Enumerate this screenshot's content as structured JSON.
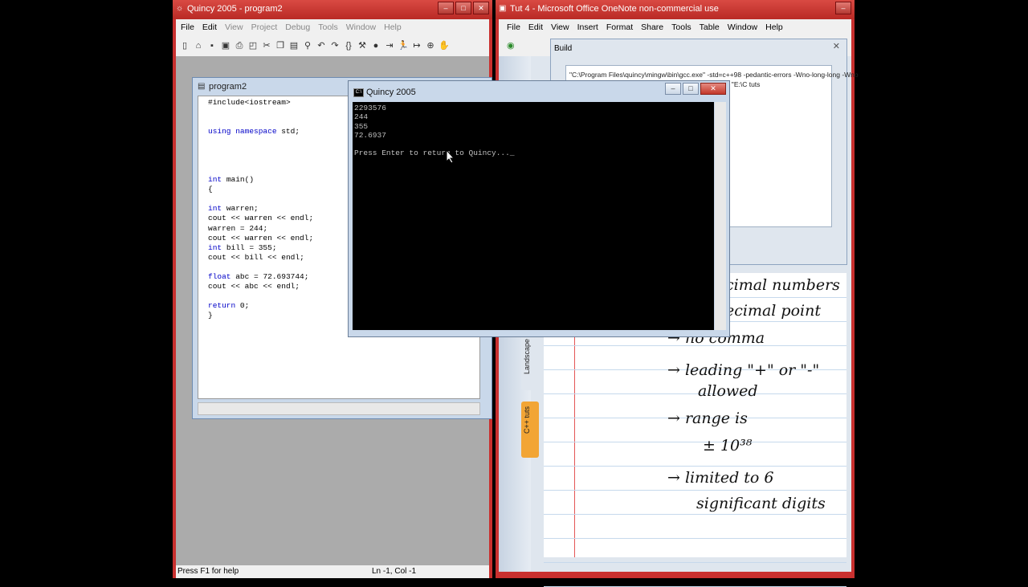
{
  "quincy": {
    "title": "Quincy 2005 - program2",
    "menu": [
      "File",
      "Edit",
      "View",
      "Project",
      "Debug",
      "Tools",
      "Window",
      "Help"
    ],
    "child_title": "program2",
    "code_lines": [
      "#include<iostream>",
      "",
      "",
      "using namespace std;",
      "",
      "",
      "",
      "",
      "int main()",
      "{",
      "",
      "int warren;",
      "cout << warren << endl;",
      "warren = 244;",
      "cout << warren << endl;",
      "int bill = 355;",
      "cout << bill << endl;",
      "",
      "float abc = 72.693744;",
      "cout << abc << endl;",
      "",
      "return 0;",
      "}"
    ],
    "status_help": "Press F1 for help",
    "status_pos": "Ln -1, Col -1"
  },
  "console": {
    "title": "Quincy 2005",
    "lines": [
      "2293576",
      "244",
      "355",
      "72.6937",
      "",
      "Press Enter to return to Quincy..._"
    ]
  },
  "onenote": {
    "title": "Tut 4 - Microsoft Office OneNote non-commercial use",
    "menu": [
      "File",
      "Edit",
      "View",
      "Insert",
      "Format",
      "Share",
      "Tools",
      "Table",
      "Window",
      "Help"
    ],
    "build_title": "Build",
    "build_lines": [
      "\"C:\\Program Files\\quincy\\mingw\\bin\\gcc.exe\" -std=c++98 -pedantic-errors -Wno-long-long -Wno",
      "\"E:\\C tuts\\program2.exe\" \"E:\\C tuts"
    ],
    "tabs": [
      "Landscape",
      "C++ tuts"
    ],
    "notes": [
      "cimal numbers",
      "ecimal point",
      "→ no comma",
      "→ leading \"+\" or \"-\"",
      "allowed",
      "→ range is",
      "± 10³⁸",
      "→ limited to 6",
      "significant digits"
    ]
  }
}
